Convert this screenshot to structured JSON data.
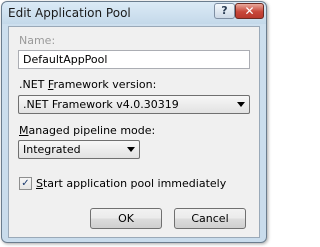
{
  "window": {
    "title": "Edit Application Pool",
    "help_glyph": "?",
    "close_glyph": "✕"
  },
  "name_field": {
    "label": "Name:",
    "value": "DefaultAppPool"
  },
  "framework": {
    "label_pre": ".NET ",
    "label_key": "F",
    "label_post": "ramework version:",
    "selected": ".NET Framework v4.0.30319"
  },
  "pipeline": {
    "label_key": "M",
    "label_post": "anaged pipeline mode:",
    "selected": "Integrated"
  },
  "start_immediately": {
    "checked": true,
    "check_glyph": "✓",
    "label_key": "S",
    "label_post": "tart application pool immediately"
  },
  "buttons": {
    "ok": "OK",
    "cancel": "Cancel"
  }
}
